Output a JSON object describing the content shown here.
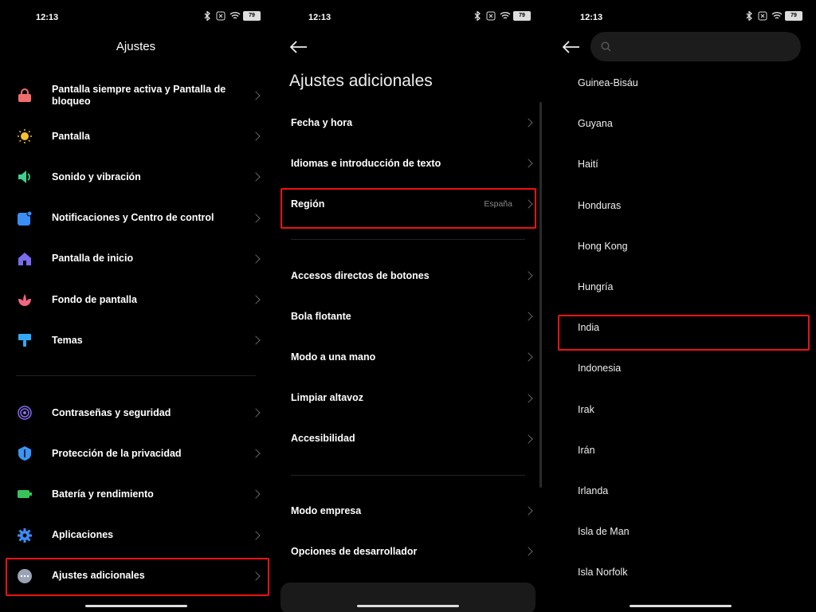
{
  "status": {
    "time": "12:13",
    "battery": "79"
  },
  "panel1": {
    "title": "Ajustes",
    "group1": [
      {
        "label": "Pantalla siempre activa y Pantalla de bloqueo",
        "icon": "lock-icon",
        "color": "#f26d6d"
      },
      {
        "label": "Pantalla",
        "icon": "sun-icon",
        "color": "#f5c12e"
      },
      {
        "label": "Sonido y vibración",
        "icon": "speaker-icon",
        "color": "#3fcf8e"
      },
      {
        "label": "Notificaciones y Centro de control",
        "icon": "notification-icon",
        "color": "#3b8df7"
      },
      {
        "label": "Pantalla de inicio",
        "icon": "home-icon",
        "color": "#7a6cf2"
      },
      {
        "label": "Fondo de pantalla",
        "icon": "flower-icon",
        "color": "#f2677f"
      },
      {
        "label": "Temas",
        "icon": "paintbrush-icon",
        "color": "#33a9f5"
      }
    ],
    "group2": [
      {
        "label": "Contraseñas y seguridad",
        "icon": "fingerprint-icon",
        "color": "#8a6cf2"
      },
      {
        "label": "Protección de la privacidad",
        "icon": "shield-icon",
        "color": "#3b95f5"
      },
      {
        "label": "Batería y rendimiento",
        "icon": "battery-icon",
        "color": "#39c25c"
      },
      {
        "label": "Aplicaciones",
        "icon": "gear-icon",
        "color": "#3b8df7"
      },
      {
        "label": "Ajustes adicionales",
        "icon": "more-dots-icon",
        "color": "#9aa3b5"
      }
    ]
  },
  "panel2": {
    "title": "Ajustes adicionales",
    "group1": [
      {
        "label": "Fecha y hora",
        "value": ""
      },
      {
        "label": "Idiomas e introducción de texto",
        "value": ""
      },
      {
        "label": "Región",
        "value": "España"
      }
    ],
    "group2": [
      {
        "label": "Accesos directos de botones"
      },
      {
        "label": "Bola flotante"
      },
      {
        "label": "Modo a una mano"
      },
      {
        "label": "Limpiar altavoz"
      },
      {
        "label": "Accesibilidad"
      }
    ],
    "group3": [
      {
        "label": "Modo empresa"
      },
      {
        "label": "Opciones de desarrollador"
      }
    ]
  },
  "panel3": {
    "search_placeholder": "",
    "countries": [
      "Guinea-Bisáu",
      "Guyana",
      "Haití",
      "Honduras",
      "Hong Kong",
      "Hungría",
      "India",
      "Indonesia",
      "Irak",
      "Irán",
      "Irlanda",
      "Isla de Man",
      "Isla Norfolk"
    ]
  }
}
